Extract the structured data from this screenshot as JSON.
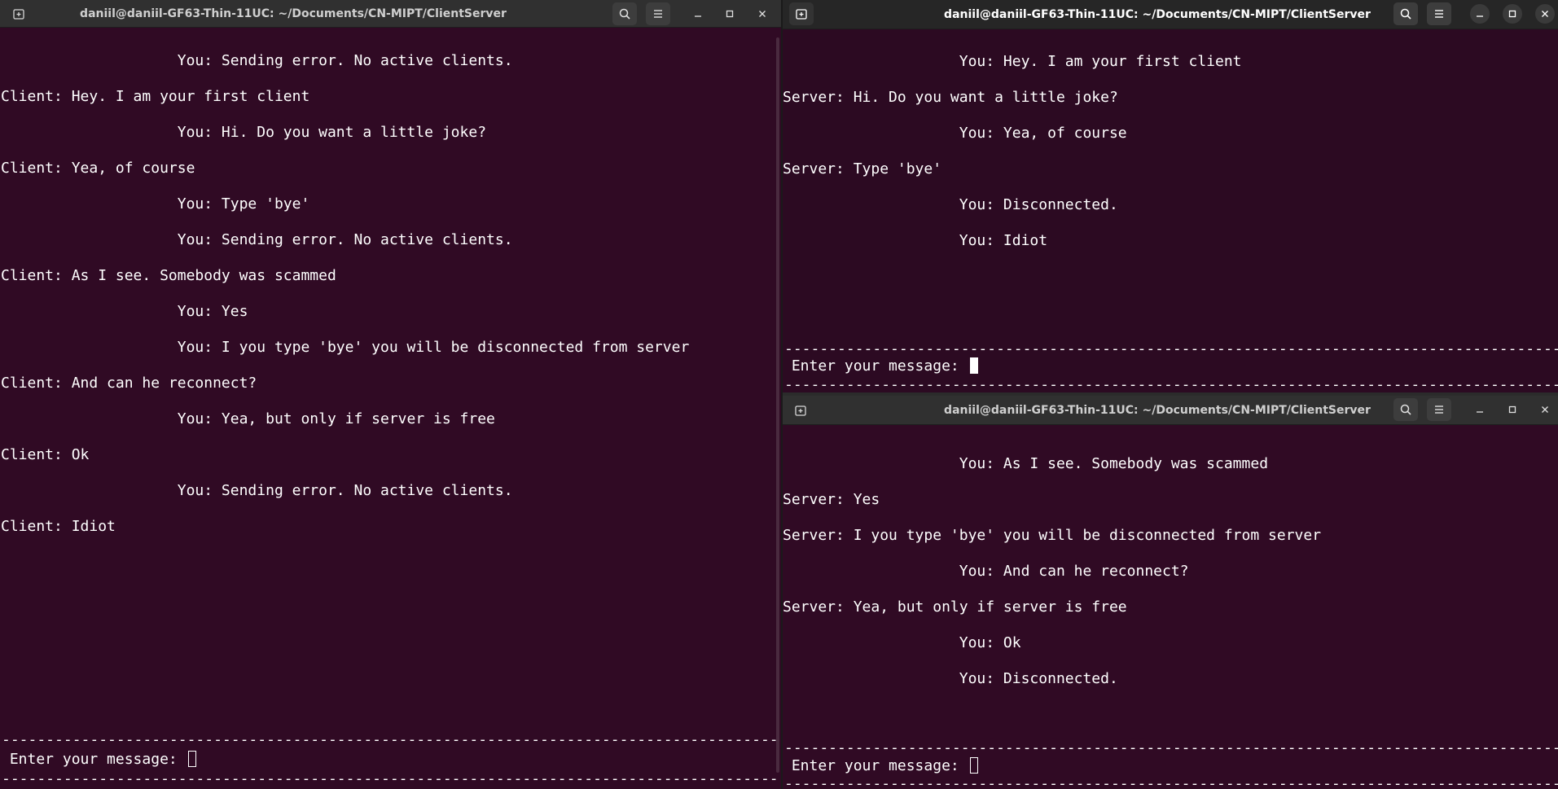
{
  "title_text": "daniil@daniil-GF63-Thin-11UC: ~/Documents/CN-MIPT/ClientServer",
  "windows": {
    "server": {
      "title": "daniil@daniil-GF63-Thin-11UC: ~/Documents/CN-MIPT/ClientServer",
      "lines": [
        "                    You: Sending error. No active clients.",
        "Client: Hey. I am your first client",
        "                    You: Hi. Do you want a little joke?",
        "Client: Yea, of course",
        "                    You: Type 'bye'",
        "                    You: Sending error. No active clients.",
        "Client: As I see. Somebody was scammed",
        "                    You: Yes",
        "                    You: I you type 'bye' you will be disconnected from server",
        "Client: And can he reconnect?",
        "                    You: Yea, but only if server is free",
        "Client: Ok",
        "                    You: Sending error. No active clients.",
        "Client: Idiot"
      ],
      "separator": "----------------------------------------------------------------------------------------",
      "prompt": " Enter your message: "
    },
    "client1": {
      "title": "daniil@daniil-GF63-Thin-11UC: ~/Documents/CN-MIPT/ClientServer",
      "lines": [
        "                    You: Hey. I am your first client",
        "Server: Hi. Do you want a little joke?",
        "                    You: Yea, of course",
        "Server: Type 'bye'",
        "                    You: Disconnected.",
        "                    You: Idiot"
      ],
      "separator": "----------------------------------------------------------------------------------------",
      "prompt": " Enter your message: "
    },
    "client2": {
      "title": "daniil@daniil-GF63-Thin-11UC: ~/Documents/CN-MIPT/ClientServer",
      "lines": [
        "                    You: As I see. Somebody was scammed",
        "Server: Yes",
        "Server: I you type 'bye' you will be disconnected from server",
        "                    You: And can he reconnect?",
        "Server: Yea, but only if server is free",
        "                    You: Ok",
        "                    You: Disconnected."
      ],
      "separator": "----------------------------------------------------------------------------------------",
      "prompt": " Enter your message: "
    }
  },
  "icons": {
    "new_tab": "new-tab-icon",
    "search": "search-icon",
    "menu": "hamburger-menu-icon",
    "minimize": "minimize-icon",
    "maximize": "maximize-icon",
    "close": "close-icon"
  },
  "colors": {
    "terminal_bg": "#300a24",
    "titlebar_bg": "#303030",
    "text": "#ffffff"
  }
}
